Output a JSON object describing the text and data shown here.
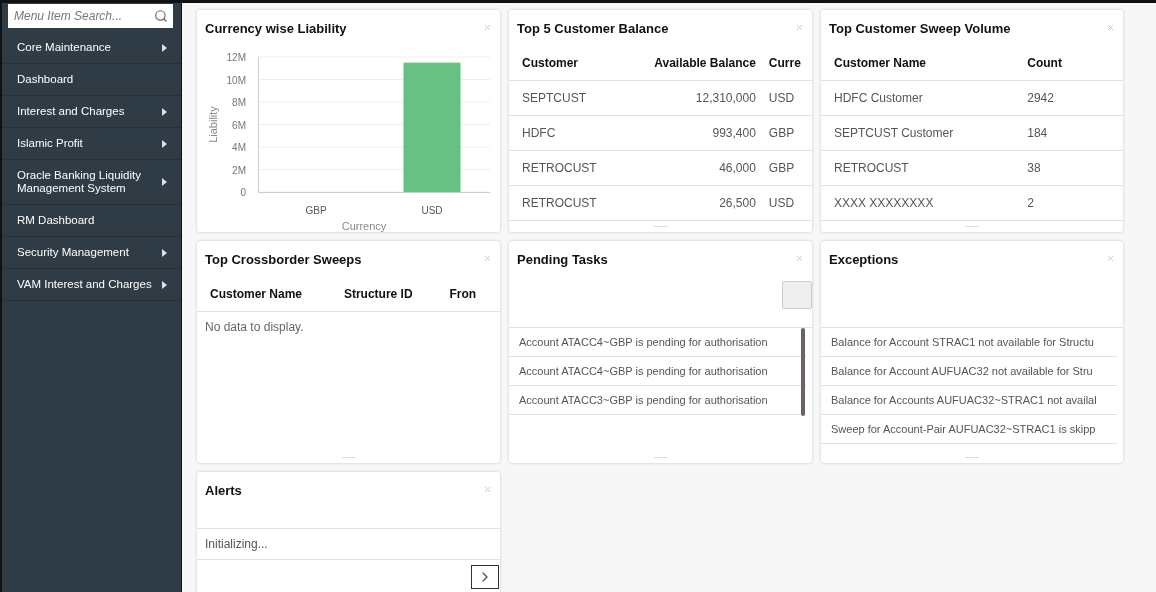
{
  "sidebar": {
    "search": {
      "placeholder": "Menu Item Search..."
    },
    "items": [
      {
        "label": "Core Maintenance",
        "has_submenu": true
      },
      {
        "label": "Dashboard",
        "has_submenu": false
      },
      {
        "label": "Interest and Charges",
        "has_submenu": true
      },
      {
        "label": "Islamic Profit",
        "has_submenu": true
      },
      {
        "label": "Oracle Banking Liquidity Management System",
        "has_submenu": true
      },
      {
        "label": "RM Dashboard",
        "has_submenu": false
      },
      {
        "label": "Security Management",
        "has_submenu": true
      },
      {
        "label": "VAM Interest and Charges",
        "has_submenu": true
      }
    ]
  },
  "widgets": [
    {
      "kind": "chart",
      "title": "Currency wise Liability",
      "chart_data": {
        "type": "bar",
        "xlabel": "Currency",
        "ylabel": "Liability",
        "categories": [
          "GBP",
          "USD"
        ],
        "values": [
          0,
          11500000
        ],
        "grid": true,
        "ylim": [
          0,
          12000000
        ],
        "yticks": [
          {
            "value": 0,
            "label": "0"
          },
          {
            "value": 2000000,
            "label": "2M"
          },
          {
            "value": 4000000,
            "label": "4M"
          },
          {
            "value": 6000000,
            "label": "6M"
          },
          {
            "value": 8000000,
            "label": "8M"
          },
          {
            "value": 10000000,
            "label": "10M"
          },
          {
            "value": 12000000,
            "label": "12M"
          }
        ]
      }
    },
    {
      "kind": "table",
      "title": "Top 5 Customer Balance",
      "columns": [
        {
          "label": "Customer",
          "kind": "text"
        },
        {
          "label": "Available Balance",
          "kind": "number"
        },
        {
          "label": "Curre",
          "kind": "text"
        }
      ],
      "rows": [
        [
          "SEPTCUST",
          "12,310,000",
          "USD"
        ],
        [
          "HDFC",
          "993,400",
          "GBP"
        ],
        [
          "RETROCUST",
          "46,000",
          "GBP"
        ],
        [
          "RETROCUST",
          "26,500",
          "USD"
        ]
      ]
    },
    {
      "kind": "table",
      "title": "Top Customer Sweep Volume",
      "columns": [
        {
          "label": "Customer Name",
          "kind": "text"
        },
        {
          "label": "Count",
          "kind": "text"
        }
      ],
      "rows": [
        [
          "HDFC Customer",
          "2942"
        ],
        [
          "SEPTCUST Customer",
          "184"
        ],
        [
          "RETROCUST",
          "38"
        ],
        [
          "XXXX XXXXXXXX",
          "2"
        ]
      ]
    },
    {
      "kind": "table",
      "title": "Top Crossborder Sweeps",
      "columns": [
        {
          "label": "Customer Name",
          "kind": "text"
        },
        {
          "label": "Structure ID",
          "kind": "text"
        },
        {
          "label": "Fron",
          "kind": "text"
        }
      ],
      "empty_message": "No data to display."
    },
    {
      "kind": "list",
      "title": "Pending Tasks",
      "action_button": true,
      "scrollbar": true,
      "items": [
        "Account ATACC4~GBP is pending for authorisation",
        "Account ATACC4~GBP is pending for authorisation",
        "Account ATACC3~GBP is pending for authorisation"
      ]
    },
    {
      "kind": "list",
      "title": "Exceptions",
      "action_button": false,
      "scrollbar": false,
      "items": [
        "Balance for Account STRAC1 not available for Structu",
        "Balance for Account AUFUAC32 not available for Stru",
        "Balance for Accounts AUFUAC32~STRAC1 not availal",
        "Sweep for Account-Pair AUFUAC32~STRAC1 is skipp"
      ]
    },
    {
      "kind": "status",
      "title": "Alerts",
      "status": "Initializing..."
    }
  ]
}
